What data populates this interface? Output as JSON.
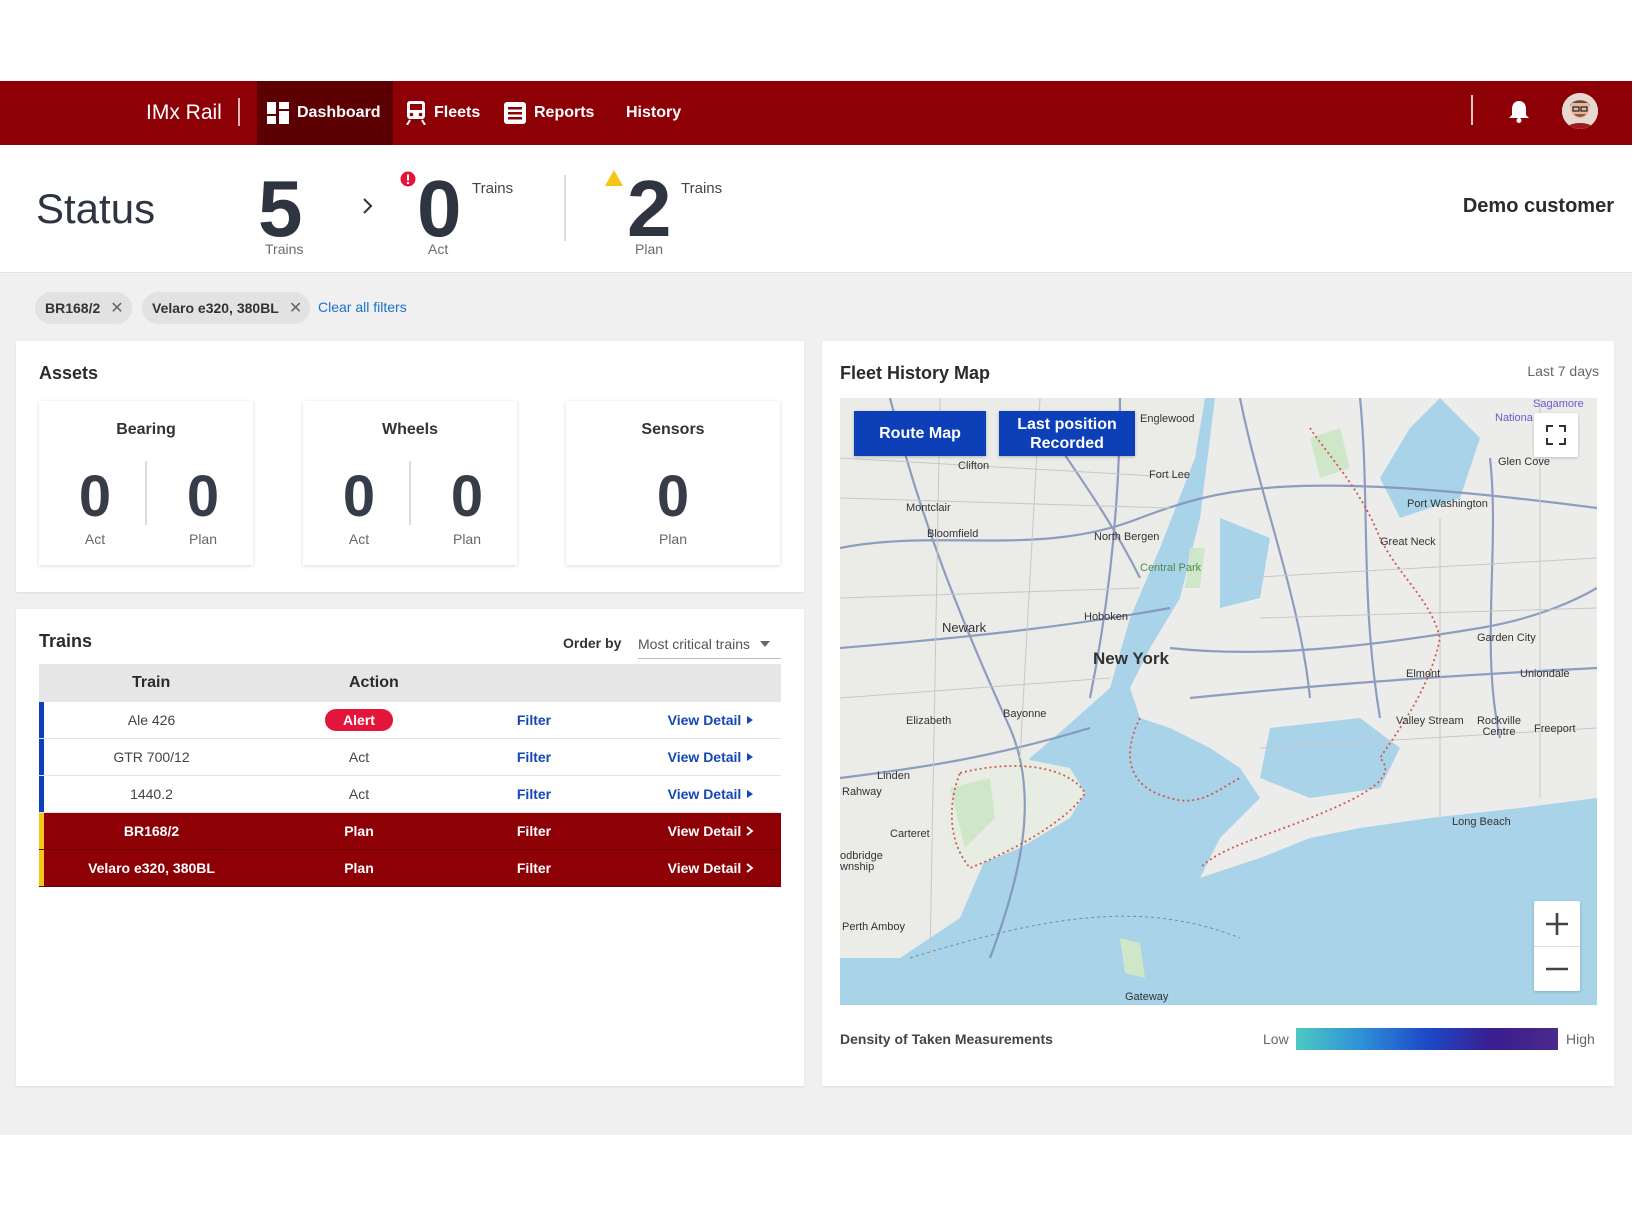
{
  "nav": {
    "brand": "IMx Rail",
    "items": [
      {
        "label": "Dashboard",
        "icon": "dashboard-icon",
        "active": true
      },
      {
        "label": "Fleets",
        "icon": "train-icon",
        "active": false
      },
      {
        "label": "Reports",
        "icon": "reports-icon",
        "active": false
      },
      {
        "label": "History",
        "icon": "",
        "active": false
      }
    ],
    "bell_icon": "bell-icon",
    "avatar_icon": "user-avatar"
  },
  "status": {
    "title": "Status",
    "total": {
      "value": "5",
      "label": "Trains"
    },
    "act": {
      "value": "0",
      "unit": "Trains",
      "label": "Act",
      "badge_icon": "alert-circle-icon"
    },
    "plan": {
      "value": "2",
      "unit": "Trains",
      "label": "Plan",
      "badge_icon": "warning-triangle-icon"
    },
    "customer": "Demo customer"
  },
  "filters": {
    "chips": [
      "BR168/2",
      "Velaro e320, 380BL"
    ],
    "clear_label": "Clear all filters"
  },
  "assets": {
    "title": "Assets",
    "boxes": [
      {
        "name": "Bearing",
        "act": "0",
        "act_label": "Act",
        "plan": "0",
        "plan_label": "Plan"
      },
      {
        "name": "Wheels",
        "act": "0",
        "act_label": "Act",
        "plan": "0",
        "plan_label": "Plan"
      },
      {
        "name": "Sensors",
        "plan": "0",
        "plan_label": "Plan"
      }
    ]
  },
  "trains": {
    "title": "Trains",
    "order_by_label": "Order by",
    "order_by_value": "Most critical trains",
    "headers": {
      "train": "Train",
      "action": "Action"
    },
    "rows": [
      {
        "train": "Ale 426",
        "action": "Alert",
        "filter": "Filter",
        "detail": "View Detail",
        "style": "alert",
        "edge": "#0c3fb8"
      },
      {
        "train": "GTR 700/12",
        "action": "Act",
        "filter": "Filter",
        "detail": "View Detail",
        "style": "normal",
        "edge": "#0c3fb8"
      },
      {
        "train": "1440.2",
        "action": "Act",
        "filter": "Filter",
        "detail": "View Detail",
        "style": "normal",
        "edge": "#0c3fb8"
      },
      {
        "train": "BR168/2",
        "action": "Plan",
        "filter": "Filter",
        "detail": "View Detail",
        "style": "red",
        "edge": "#f5c518"
      },
      {
        "train": "Velaro e320, 380BL",
        "action": "Plan",
        "filter": "Filter",
        "detail": "View Detail",
        "style": "red",
        "edge": "#f5c518"
      }
    ]
  },
  "map": {
    "title": "Fleet History Map",
    "period": "Last 7 days",
    "buttons": {
      "route": "Route Map",
      "last_position": "Last position Recorded"
    },
    "labels": {
      "englewood": "Englewood",
      "clifton": "Clifton",
      "fort_lee": "Fort Lee",
      "montclair": "Montclair",
      "bloomfield": "Bloomfield",
      "north_bergen": "North Bergen",
      "central_park": "Central Park",
      "hoboken": "Hoboken",
      "newark": "Newark",
      "new_york": "New York",
      "elizabeth": "Elizabeth",
      "bayonne": "Bayonne",
      "linden": "Linden",
      "rahway": "Rahway",
      "carteret": "Carteret",
      "woodbridge": "odbridge",
      "township": "wnship",
      "perth_amboy": "Perth Amboy",
      "gateway": "Gateway",
      "glen_cove": "Glen Cove",
      "port_washington": "Port Washington",
      "great_neck": "Great Neck",
      "garden_city": "Garden City",
      "elmont": "Elmont",
      "uniondale": "Uniondale",
      "valley_stream": "Valley Stream",
      "rockville_centre": "Rockville Centre",
      "freeport": "Freeport",
      "long_beach": "Long Beach",
      "sagamore": "Sagamore",
      "nationa": "Nationa"
    },
    "legend": {
      "title": "Density of Taken Measurements",
      "low": "Low",
      "high": "High"
    }
  },
  "colors": {
    "brand": "#8d0006",
    "brand_dark": "#5d0004",
    "link": "#1346b8",
    "alert": "#e3153a",
    "warning": "#f5c518",
    "map_button": "#0c3fb8"
  }
}
